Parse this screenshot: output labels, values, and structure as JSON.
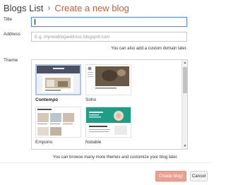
{
  "header": {
    "root": "Blogs List",
    "separator": "›",
    "current": "Create a new blog"
  },
  "form": {
    "title_label": "Title",
    "title_value": "",
    "address_label": "Address",
    "address_placeholder": "E.g. mynewblogaddress.blogspot.com",
    "address_hint": "You can also add a custom domain later.",
    "theme_label": "Theme"
  },
  "themes": [
    {
      "name": "Contempo",
      "selected": true
    },
    {
      "name": "Soho",
      "selected": false
    },
    {
      "name": "Emporio",
      "selected": false
    },
    {
      "name": "Notable",
      "selected": false
    }
  ],
  "theme_hint": "You can browse many more themes and customize your blog later.",
  "buttons": {
    "create": "Create blog!",
    "cancel": "Cancel"
  },
  "colors": {
    "accent": "#dd5b2b",
    "create_button": "#eda090",
    "focus_border": "#4d90fe",
    "selected_theme_border": "#a9c6ee",
    "notable_teal": "#1f9e86"
  }
}
